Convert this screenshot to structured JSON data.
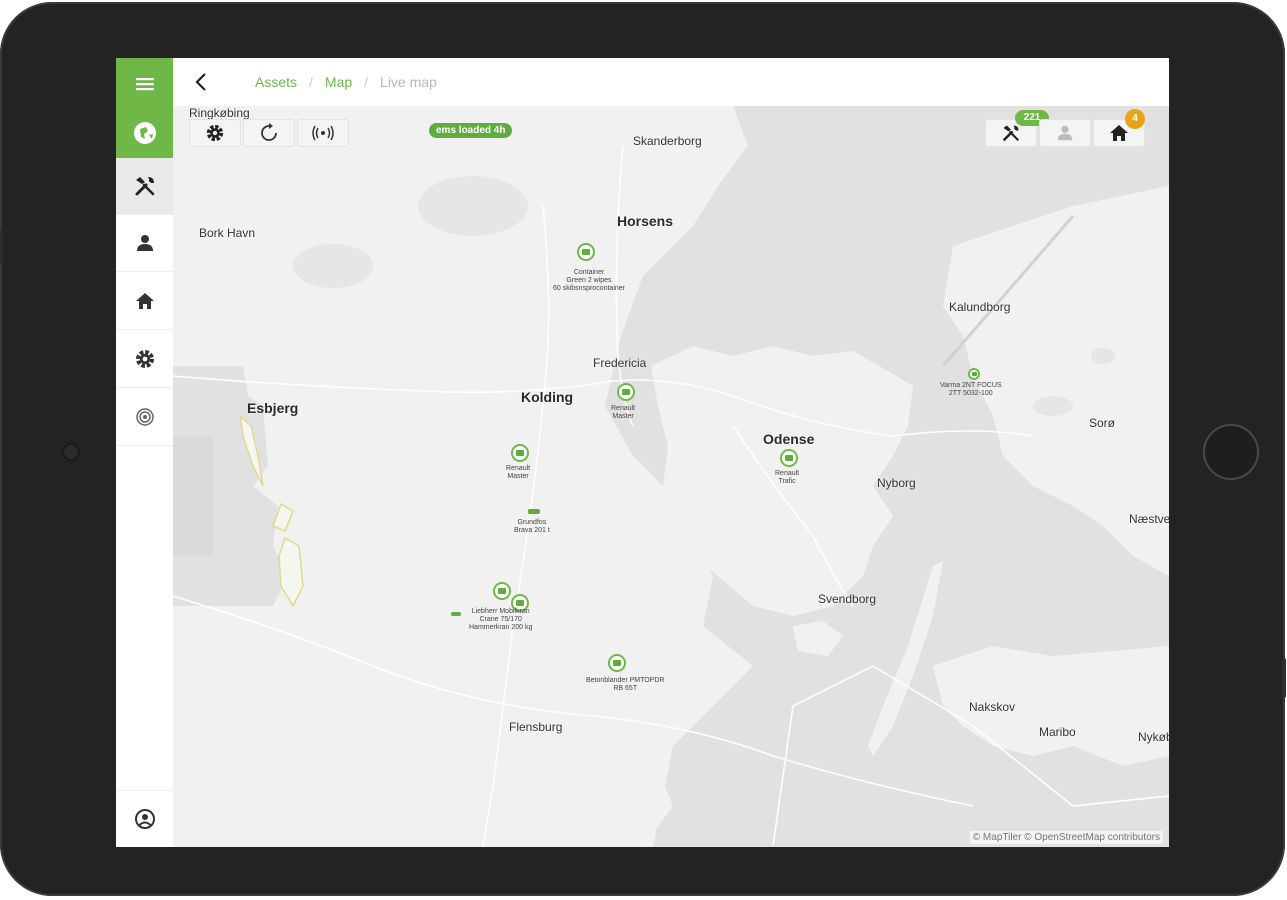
{
  "breadcrumb": {
    "items": [
      "Assets",
      "Map",
      "Live map"
    ],
    "separator": "/"
  },
  "toolbar": {
    "loaded_pill": "ems loaded 4h"
  },
  "top_right": {
    "tools_count": "221",
    "home_count": "4"
  },
  "cities": [
    {
      "name": "Ringkøbing",
      "big": false
    },
    {
      "name": "Skanderborg",
      "big": false
    },
    {
      "name": "Horsens",
      "big": true
    },
    {
      "name": "Bork Havn",
      "big": false
    },
    {
      "name": "Kalundborg",
      "big": false
    },
    {
      "name": "Fredericia",
      "big": false
    },
    {
      "name": "Kolding",
      "big": true
    },
    {
      "name": "Esbjerg",
      "big": true
    },
    {
      "name": "Odense",
      "big": true
    },
    {
      "name": "Sorø",
      "big": false
    },
    {
      "name": "Nyborg",
      "big": false
    },
    {
      "name": "Næstved",
      "big": false
    },
    {
      "name": "Svendborg",
      "big": false
    },
    {
      "name": "Flensburg",
      "big": false
    },
    {
      "name": "Nakskov",
      "big": false
    },
    {
      "name": "Maribo",
      "big": false
    },
    {
      "name": "Nykøb",
      "big": false
    }
  ],
  "markers": [
    {
      "label": "Container\nGreen 2 wipes\n60 skibsnsprocontainer"
    },
    {
      "label": "Varma 2NT FOCUS\n2TT 5032-100"
    },
    {
      "label": "Renault\nMaster"
    },
    {
      "label": "Renault\nMaster"
    },
    {
      "label": "Renault\nTrafic"
    },
    {
      "label": "Grundfos\nBrava 201 t"
    },
    {
      "label": "Liebherr Mobilkran\nCrane 75/170\nHammerkran 200 kg"
    },
    {
      "label": "Betonblander PMTOPDR\nRB 65T"
    }
  ],
  "attribution": "© MapTiler © OpenStreetMap contributors",
  "colors": {
    "accent": "#6fb848",
    "badge_orange": "#e8a417",
    "frame": "#232323"
  }
}
